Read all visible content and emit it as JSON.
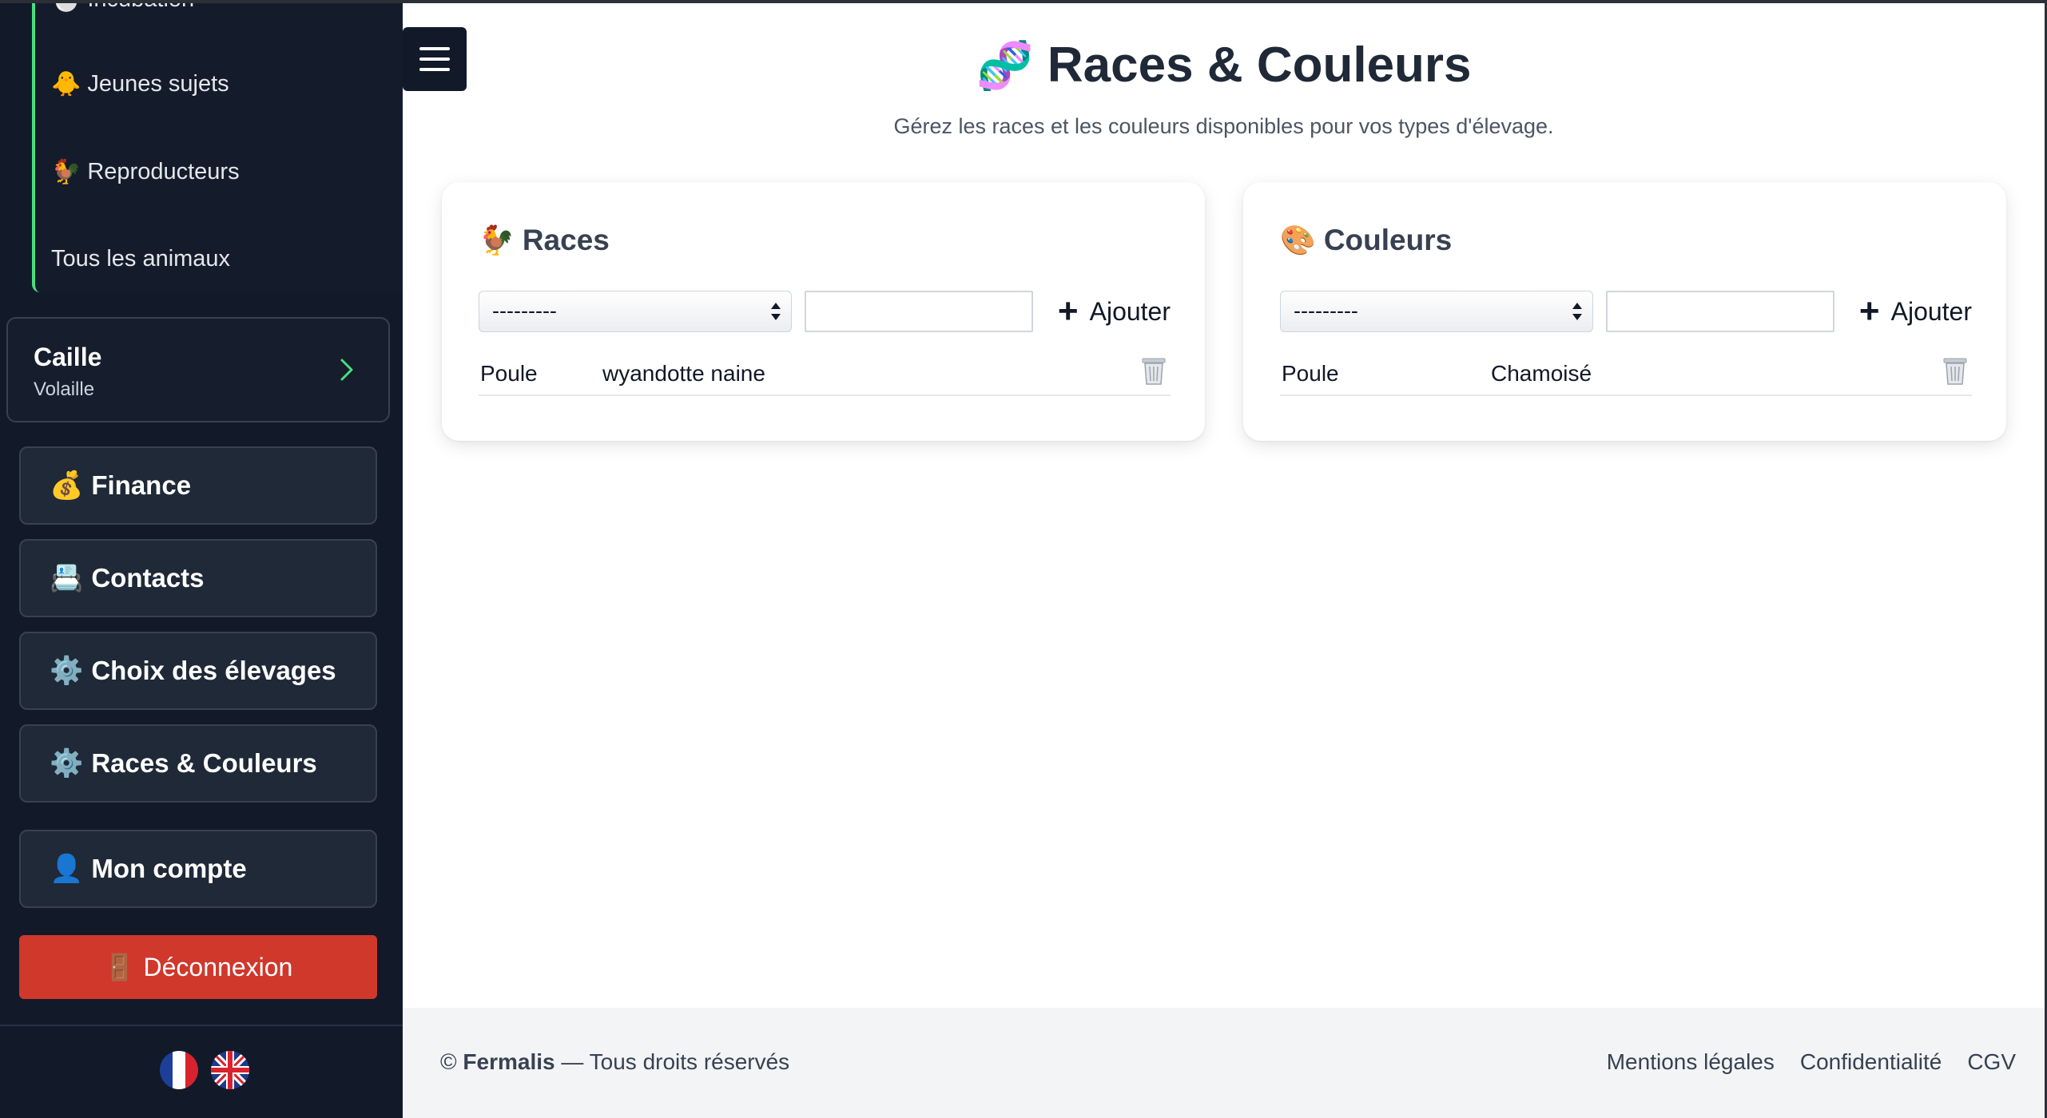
{
  "sidebar": {
    "subnav": [
      {
        "emoji": "🐣",
        "label": "Incubation"
      },
      {
        "emoji": "🐥",
        "label": "Jeunes sujets"
      },
      {
        "emoji": "🐓",
        "label": "Reproducteurs"
      },
      {
        "emoji": "",
        "label": "Tous les animaux"
      }
    ],
    "species": {
      "name": "Caille",
      "type": "Volaille"
    },
    "menu": [
      {
        "emoji": "💰",
        "label": "Finance"
      },
      {
        "emoji": "📇",
        "label": "Contacts"
      },
      {
        "emoji": "⚙️",
        "label": "Choix des élevages"
      },
      {
        "emoji": "⚙️",
        "label": "Races & Couleurs"
      },
      {
        "emoji": "👤",
        "label": "Mon compte"
      }
    ],
    "logout": {
      "emoji": "🚪",
      "label": "Déconnexion"
    }
  },
  "header": {
    "emoji": "🧬",
    "title": "Races & Couleurs",
    "subtitle": "Gérez les races et les couleurs disponibles pour vos types d'élevage."
  },
  "races_panel": {
    "emoji": "🐓",
    "title": "Races",
    "select_value": "---------",
    "add_label": "Ajouter",
    "rows": [
      {
        "type": "Poule",
        "name": "wyandotte naine"
      }
    ]
  },
  "couleurs_panel": {
    "emoji": "🎨",
    "title": "Couleurs",
    "select_value": "---------",
    "add_label": "Ajouter",
    "rows": [
      {
        "type": "Poule",
        "name": "Chamoisé"
      }
    ]
  },
  "footer": {
    "copyright": "©",
    "brand": "Fermalis",
    "rights": "— Tous droits réservés",
    "links": [
      "Mentions légales",
      "Confidentialité",
      "CGV"
    ]
  },
  "colors": {
    "sidebar_bg": "#121a29",
    "accent_green": "#4ade80",
    "logout_red": "#d0382c"
  }
}
